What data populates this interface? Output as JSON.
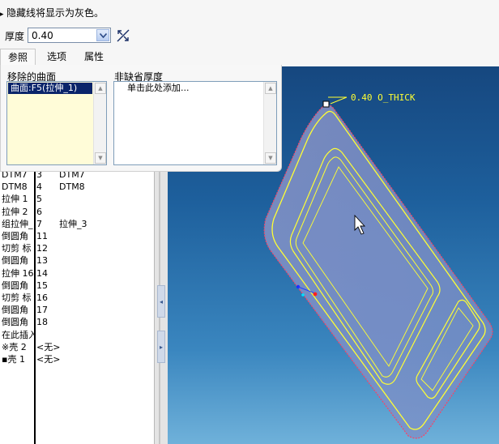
{
  "hint": {
    "text": "隐藏线将显示为灰色。"
  },
  "dashboard": {
    "thickness_label": "厚度",
    "thickness_value": "0.40"
  },
  "tabs": [
    {
      "label": "参照"
    },
    {
      "label": "选项"
    },
    {
      "label": "属性"
    }
  ],
  "panel": {
    "removed_surfaces_label": "移除的曲面",
    "removed_surfaces_item": "曲面:F5(拉伸_1)",
    "nondefault_thickness_label": "非缺省厚度",
    "nondefault_thickness_add": "单击此处添加..."
  },
  "tree": {
    "rows": [
      {
        "c1": "DTM7",
        "c2": "3",
        "c3": "DTM7"
      },
      {
        "c1": "DTM8",
        "c2": "4",
        "c3": "DTM8"
      },
      {
        "c1": "拉伸 1",
        "c2": "5",
        "c3": ""
      },
      {
        "c1": "拉伸 2",
        "c2": "6",
        "c3": ""
      },
      {
        "c1": "组拉伸_",
        "c2": "7",
        "c3": "拉伸_3"
      },
      {
        "c1": "倒圆角",
        "c2": "11",
        "c3": ""
      },
      {
        "c1": "切剪 标",
        "c2": "12",
        "c3": ""
      },
      {
        "c1": "倒圆角",
        "c2": "13",
        "c3": ""
      },
      {
        "c1": "拉伸 16",
        "c2": "14",
        "c3": ""
      },
      {
        "c1": "倒圆角",
        "c2": "15",
        "c3": ""
      },
      {
        "c1": "切剪 标",
        "c2": "16",
        "c3": ""
      },
      {
        "c1": "倒圆角",
        "c2": "17",
        "c3": ""
      },
      {
        "c1": "倒圆角",
        "c2": "18",
        "c3": ""
      },
      {
        "c1": "在此插入",
        "c2": "",
        "c3": ""
      },
      {
        "c1": "※壳 2",
        "c2": "<无>",
        "c3": ""
      },
      {
        "c1": "▪壳 1",
        "c2": "<无>",
        "c3": ""
      }
    ]
  },
  "viewport": {
    "dimension_label": "0.40 O_THICK"
  },
  "colors": {
    "selection": "#0a246a",
    "list_highlight": "#fffcd8",
    "model_edge": "#ffff33",
    "datum_red": "#ff2020"
  }
}
